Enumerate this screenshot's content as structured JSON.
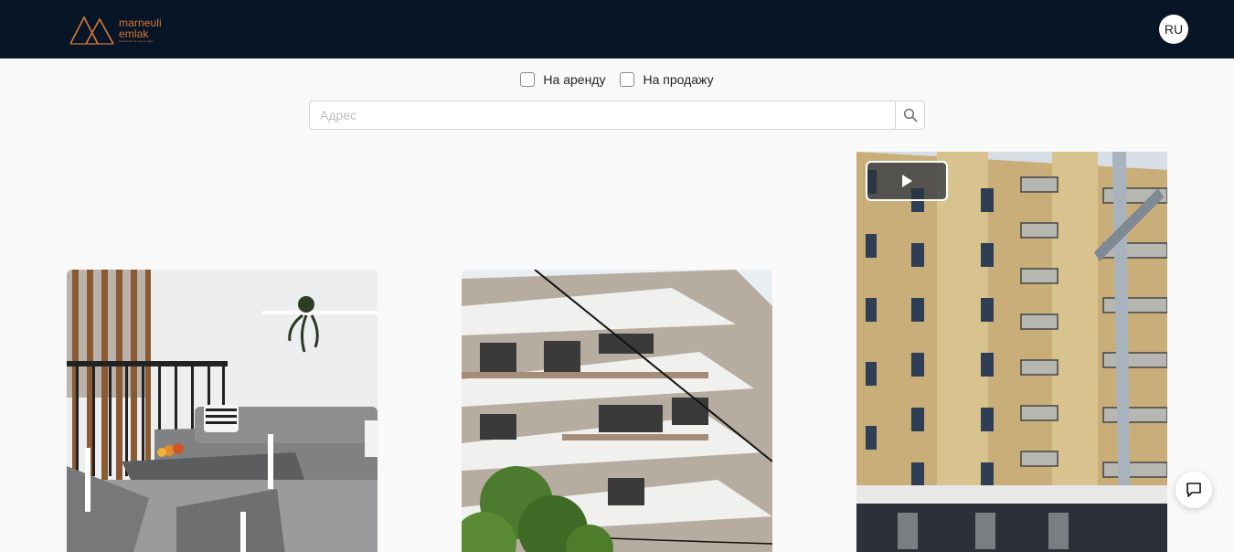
{
  "header": {
    "logo": {
      "name": "marneuli emlak",
      "tagline": "Real estate for every budget"
    },
    "language": "RU"
  },
  "filters": [
    {
      "label": "На аренду",
      "checked": false
    },
    {
      "label": "На продажу",
      "checked": false
    }
  ],
  "search": {
    "placeholder": "Адрес",
    "value": ""
  },
  "listings": [
    {
      "media": "photo",
      "subject": "balcony-with-sofa"
    },
    {
      "media": "photo",
      "subject": "building-under-construction"
    },
    {
      "media": "video",
      "subject": "residential-tower"
    }
  ],
  "colors": {
    "header_bg": "#081526",
    "brand": "#d57a3a",
    "page_bg": "#f9f9f9"
  }
}
